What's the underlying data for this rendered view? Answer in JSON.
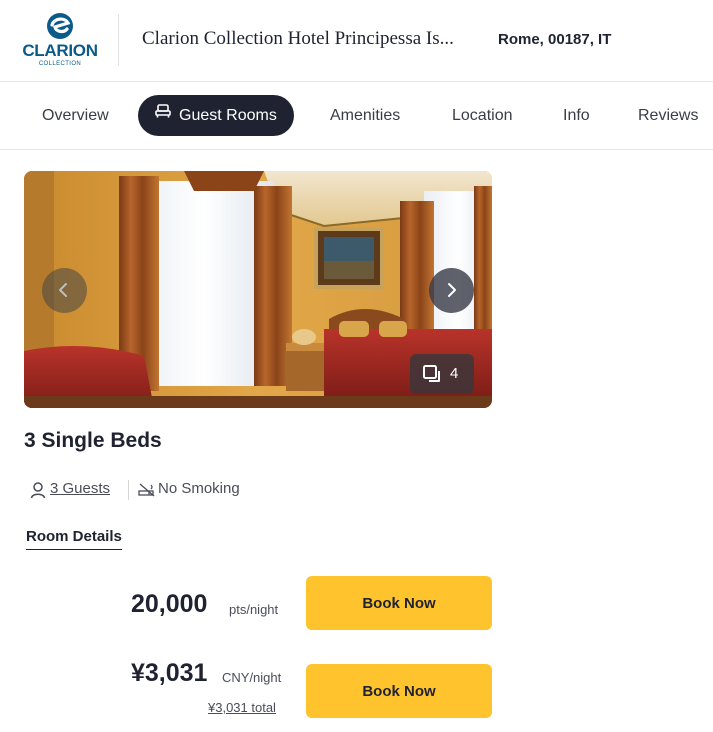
{
  "brand": {
    "name": "CLARION",
    "sub": "COLLECTION",
    "color": "#0c5a8a"
  },
  "hotel": {
    "name": "Clarion Collection Hotel Principessa Is...",
    "location": "Rome, 00187, IT"
  },
  "tabs": [
    {
      "label": "Overview"
    },
    {
      "label": "Guest Rooms",
      "icon": "bed-icon",
      "active": true
    },
    {
      "label": "Amenities"
    },
    {
      "label": "Location"
    },
    {
      "label": "Info"
    },
    {
      "label": "Reviews"
    }
  ],
  "gallery": {
    "photo_count": "4",
    "prev_icon": "chevron-left-icon",
    "next_icon": "chevron-right-icon",
    "gallery_icon": "photo-stack-icon"
  },
  "room": {
    "title": "3 Single Beds",
    "guests": "3 Guests",
    "smoking": "No Smoking",
    "details_link": "Room Details"
  },
  "rates": {
    "points": {
      "amount": "20,000",
      "unit": "pts/night",
      "button": "Book Now"
    },
    "cash": {
      "amount": "¥3,031",
      "unit": "CNY/night",
      "total": "¥3,031 total",
      "button": "Book Now"
    }
  },
  "colors": {
    "dark": "#1f2230",
    "accent": "#fec32d"
  }
}
